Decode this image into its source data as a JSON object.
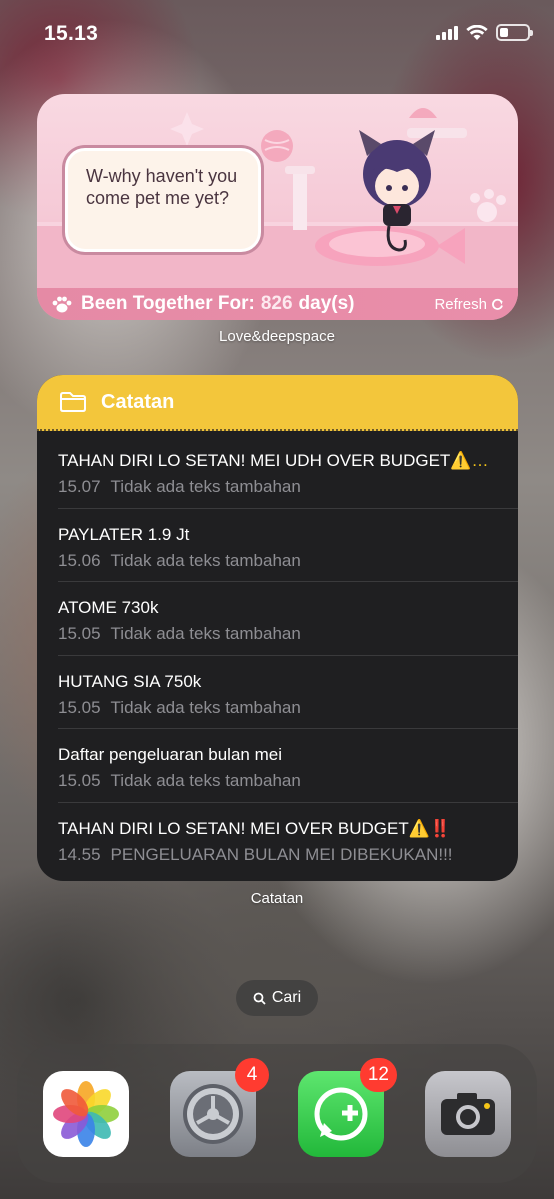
{
  "status_bar": {
    "time": "15.13",
    "battery_level": 0.3
  },
  "love_widget": {
    "speech": "W-why haven't you come pet me yet?",
    "together_label": "Been Together For:",
    "together_count": "826",
    "together_unit": "day(s)",
    "refresh_label": "Refresh",
    "caption": "Love&deepspace"
  },
  "notes_widget": {
    "title": "Catatan",
    "header_color": "#f3c63b",
    "caption": "Catatan",
    "items": [
      {
        "title": "TAHAN DIRI LO SETAN! MEI UDH OVER BUDGET",
        "emoji": "⚠️…",
        "time": "15.07",
        "subtitle": "Tidak ada teks tambahan"
      },
      {
        "title": "PAYLATER 1.9 Jt",
        "emoji": "",
        "time": "15.06",
        "subtitle": "Tidak ada teks tambahan"
      },
      {
        "title": "ATOME 730k",
        "emoji": "",
        "time": "15.05",
        "subtitle": "Tidak ada teks tambahan"
      },
      {
        "title": "HUTANG SIA 750k",
        "emoji": "",
        "time": "15.05",
        "subtitle": "Tidak ada teks tambahan"
      },
      {
        "title": "Daftar pengeluaran bulan mei",
        "emoji": "",
        "time": "15.05",
        "subtitle": "Tidak ada teks tambahan"
      },
      {
        "title": "TAHAN DIRI LO SETAN! MEI OVER BUDGET",
        "emoji": "⚠️",
        "emoji2": "‼️",
        "time": "14.55",
        "subtitle": "PENGELUARAN BULAN MEI DIBEKUKAN!!!"
      }
    ]
  },
  "search": {
    "label": "Cari",
    "icon": "search-icon"
  },
  "dock": {
    "apps": [
      {
        "name": "photos-app-icon",
        "badge": ""
      },
      {
        "name": "settings-app-icon",
        "badge": "4"
      },
      {
        "name": "whatsapp-app-icon",
        "badge": "12"
      },
      {
        "name": "camera-app-icon",
        "badge": ""
      }
    ]
  }
}
